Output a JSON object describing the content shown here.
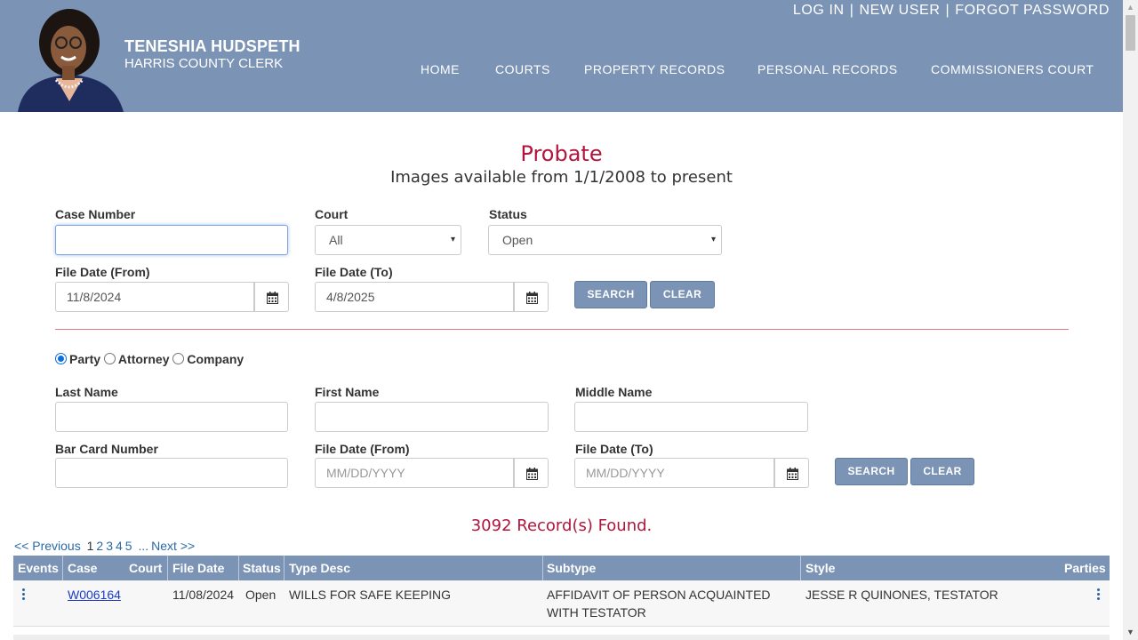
{
  "header": {
    "clerk_name": "TENESHIA HUDSPETH",
    "clerk_title": "HARRIS COUNTY CLERK",
    "top_links": [
      "LOG IN",
      "NEW USER",
      "FORGOT PASSWORD"
    ],
    "top_separator": "|",
    "nav": [
      "HOME",
      "COURTS",
      "PROPERTY RECORDS",
      "PERSONAL RECORDS",
      "COMMISSIONERS COURT"
    ],
    "bg_color": "#7b93b4"
  },
  "page": {
    "title": "Probate",
    "subtitle": "Images available from 1/1/2008 to present"
  },
  "case_search": {
    "case_number_label": "Case Number",
    "case_number_value": "",
    "court_label": "Court",
    "court_value": "All",
    "status_label": "Status",
    "status_value": "Open",
    "file_date_from_label": "File Date (From)",
    "file_date_from_value": "11/8/2024",
    "file_date_to_label": "File Date (To)",
    "file_date_to_value": "4/8/2025",
    "search_label": "SEARCH",
    "clear_label": "CLEAR"
  },
  "party_search": {
    "options": [
      "Party",
      "Attorney",
      "Company"
    ],
    "selected": "Party",
    "last_name_label": "Last Name",
    "first_name_label": "First Name",
    "middle_name_label": "Middle Name",
    "bar_card_label": "Bar Card Number",
    "file_date_from_label": "File Date (From)",
    "file_date_from_placeholder": "MM/DD/YYYY",
    "file_date_to_label": "File Date (To)",
    "file_date_to_placeholder": "MM/DD/YYYY",
    "search_label": "SEARCH",
    "clear_label": "CLEAR"
  },
  "results": {
    "records_found": "3092 Record(s) Found.",
    "pager": {
      "previous": "<< Previous",
      "pages": [
        "1",
        "2",
        "3",
        "4",
        "5"
      ],
      "current": "1",
      "ellipsis": "...",
      "next": "Next >>"
    },
    "columns": [
      "Events",
      "Case",
      "Court",
      "File Date",
      "Status",
      "Type Desc",
      "Subtype",
      "Style",
      "Parties"
    ],
    "rows": [
      {
        "case": "W006164",
        "court": "",
        "file_date": "11/08/2024",
        "status": "Open",
        "type_desc": "WILLS FOR SAFE KEEPING",
        "subtype_line1": "AFFIDAVIT OF PERSON ACQUAINTED",
        "subtype_line2": "WITH TESTATOR",
        "style": "JESSE R QUINONES, TESTATOR"
      }
    ]
  },
  "icons": [
    "calendar-icon",
    "kebab-menu-icon",
    "chevron-down-icon"
  ],
  "colors": {
    "accent_red": "#b0153d",
    "link_blue": "#2a6aa8",
    "header_blue": "#7b93b4"
  }
}
